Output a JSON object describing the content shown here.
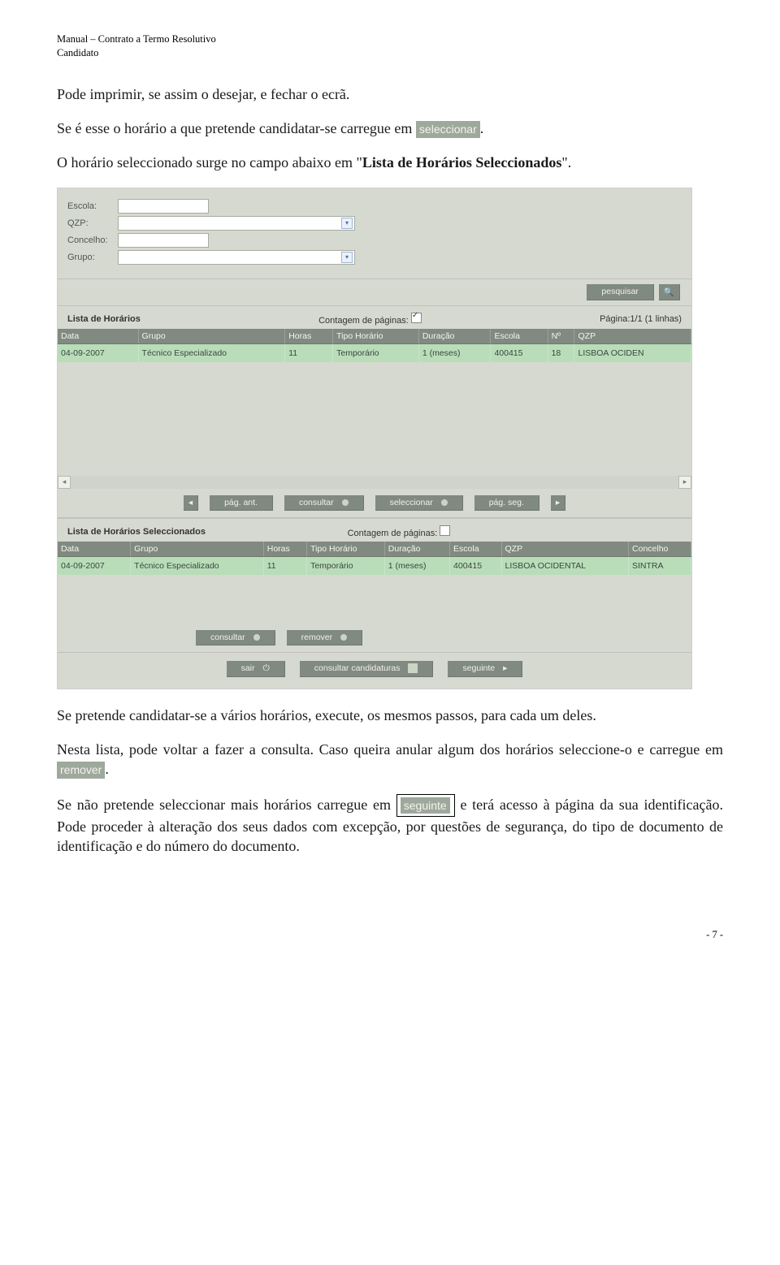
{
  "doc_header": {
    "line1": "Manual – Contrato a Termo Resolutivo",
    "line2": "Candidato"
  },
  "para1": "Pode imprimir, se assim o desejar, e fechar o ecrã.",
  "para2a": "Se é esse o horário a que pretende candidatar-se carregue em ",
  "para2btn": "seleccionar",
  "para2b": ".",
  "para3_a": "O  horário  seleccionado  surge  no  campo  abaixo  em  \"",
  "para3_b": "Lista  de  Horários",
  "para3_c": "Seleccionados",
  "para3_d": "\".",
  "screenshot": {
    "filters": {
      "escola": "Escola:",
      "qzp": "QZP:",
      "concelho": "Concelho:",
      "grupo": "Grupo:"
    },
    "search_btn": "pesquisar",
    "list1": {
      "title": "Lista de Horários",
      "contagem": "Contagem de páginas:",
      "page_info": "Página:1/1 (1 linhas)",
      "headers": [
        "Data",
        "Grupo",
        "Horas",
        "Tipo Horário",
        "Duração",
        "Escola",
        "Nº",
        "QZP"
      ],
      "row": [
        "04-09-2007",
        "Técnico Especializado",
        "11",
        "Temporário",
        "1 (meses)",
        "400415",
        "18",
        "LISBOA OCIDEN"
      ]
    },
    "nav_btns": {
      "pag_ant": "pág. ant.",
      "consultar": "consultar",
      "seleccionar": "seleccionar",
      "pag_seg": "pág. seg."
    },
    "list2": {
      "title": "Lista de Horários Seleccionados",
      "contagem": "Contagem de páginas:",
      "headers": [
        "Data",
        "Grupo",
        "Horas",
        "Tipo Horário",
        "Duração",
        "Escola",
        "QZP",
        "Concelho"
      ],
      "row": [
        "04-09-2007",
        "Técnico Especializado",
        "11",
        "Temporário",
        "1 (meses)",
        "400415",
        "LISBOA OCIDENTAL",
        "SINTRA"
      ]
    },
    "nav_btns2": {
      "consultar": "consultar",
      "remover": "remover"
    },
    "bottom": {
      "sair": "sair",
      "consultar_cand": "consultar candidaturas",
      "seguinte": "seguinte"
    }
  },
  "para4": "Se pretende candidatar-se a vários horários, execute, os mesmos passos, para cada um deles.",
  "para5a": "Nesta lista, pode voltar a fazer a consulta. Caso queira anular algum dos horários seleccione-o e carregue em ",
  "para5btn": "remover",
  "para5b": ".",
  "para6a": "Se não pretende seleccionar mais horários carregue em ",
  "para6btn": "seguinte",
  "para6b": " e terá acesso à página da sua identificação. Pode proceder à alteração dos seus dados com excepção, por questões de segurança, do tipo de documento de identificação e do número do documento.",
  "footer": "- 7 -"
}
